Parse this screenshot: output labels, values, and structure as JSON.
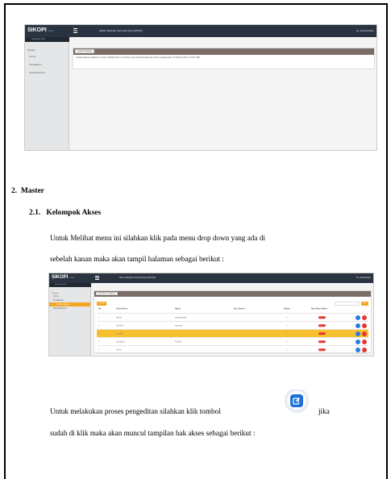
{
  "app": {
    "logo": "SIKOPI",
    "logo_suffix": "v.1.0"
  },
  "screenshot1": {
    "bar_title": "Sistem Bantuan Informasi Kopi (SIKOPI)",
    "admin": "Hi, administrator",
    "user_line": "Kelompok User",
    "sidebar": [
      "Navigasi",
      "Home",
      "Pengaturan",
      "Data Referensi"
    ],
    "panel_title": "Selamat Datang",
    "welcome": "Selamat datang di halaman member. Silahkan klik menu pilihan yang berada di bagian kiri untuk mengelola data. 27 Oktober 2022, 07:15:21 WIB"
  },
  "section": {
    "number": "2.",
    "title": "Master"
  },
  "subsection": {
    "number": "2.1.",
    "title": "Kelompok Akses"
  },
  "para1": {
    "line1": "Untuk Melihat menu ini silahkan klik pada menu drop down yang ada di",
    "line2": "sebelah kanan maka akan tampil halaman sebagai berikut :"
  },
  "screenshot2": {
    "bar_title": "Sistem Bantuan Informasi Kopi (SIKOPI)",
    "admin": "Hi, administrator",
    "user_line": "Kelompok User",
    "sidebar": [
      "Navigasi",
      "Home",
      "Pengaturan",
      "Hak Pengguna",
      "Data Referensi"
    ],
    "panel_title": "Hak Akses Pengguna",
    "add_button": "Tambah",
    "search_button": "Cari",
    "headers": [
      "No.",
      "Kode Akses",
      "Nama",
      "Ket. Sistem",
      "Status",
      "Hak Akses Menu"
    ],
    "rows": [
      {
        "no": "1",
        "code": "admin",
        "name": "administrator",
        "status": "1",
        "highlight": false
      },
      {
        "no": "2",
        "code": "operator",
        "name": "operator",
        "status": "1",
        "highlight": false
      },
      {
        "no": "3",
        "code": "pembeli",
        "name": "",
        "status": "1",
        "highlight": true
      },
      {
        "no": "4",
        "code": "pengguna",
        "name": "Pemilik",
        "status": "1",
        "highlight": false
      },
      {
        "no": "5",
        "code": "umum",
        "name": "",
        "status": "1",
        "highlight": false
      }
    ]
  },
  "para2": {
    "line1_a": "Untuk melakukan proses pengeditan silahkan klik tombol",
    "line1_b": "jika",
    "line2": "sudah di klik maka akan muncul tampilan hak akses sebagai berikut :"
  },
  "colors": {
    "accent": "#f5a623",
    "topbar": "#2a3441",
    "edit_button": "#1f6fd9",
    "danger": "#e23a2f"
  }
}
